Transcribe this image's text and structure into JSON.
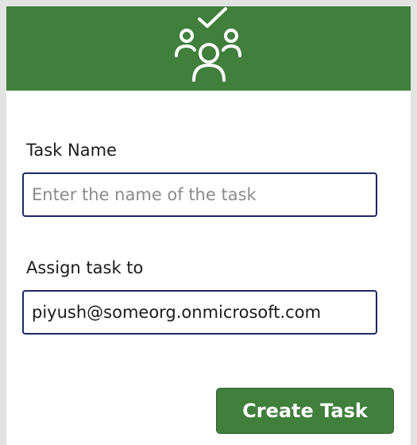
{
  "header": {
    "background_color": "#407f3c",
    "icon": "team-checkmark-icon"
  },
  "task_name": {
    "label": "Task Name",
    "placeholder": "Enter the name of the task",
    "value": ""
  },
  "assign_to": {
    "label": "Assign task to",
    "placeholder": "",
    "value": "piyush@someorg.onmicrosoft.com"
  },
  "create_button": {
    "label": "Create Task",
    "color": "#407f3c"
  },
  "colors": {
    "input_border": "#1b2a63",
    "page_background": "#e3e3e3",
    "card_background": "#ffffff"
  }
}
